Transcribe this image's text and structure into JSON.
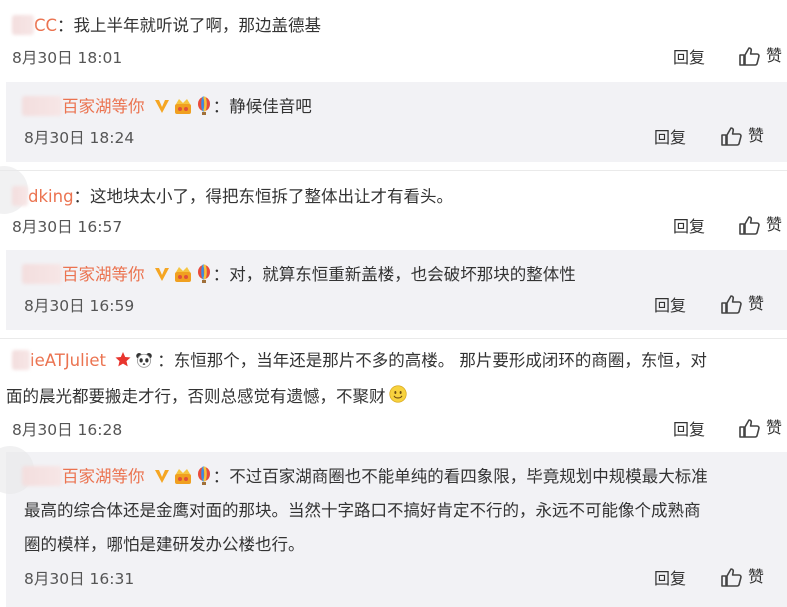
{
  "comments": [
    {
      "user_suffix": "CC",
      "separator": "：",
      "text": "我上半年就听说了啊，那边盖德基",
      "time": "8月30日 18:01",
      "reply_label": "回复",
      "like_label": "赞",
      "reply": {
        "user": "百家湖等你",
        "separator": "：",
        "text": "静候佳音吧",
        "time": "8月30日 18:24",
        "reply_label": "回复",
        "like_label": "赞"
      }
    },
    {
      "user_suffix": "dking",
      "separator": "：",
      "text": "这地块太小了，得把东恒拆了整体出让才有看头。",
      "time": "8月30日 16:57",
      "reply_label": "回复",
      "like_label": "赞",
      "reply": {
        "user": "百家湖等你",
        "separator": "：",
        "text": "对，就算东恒重新盖楼，也会破坏那块的整体性",
        "time": "8月30日 16:59",
        "reply_label": "回复",
        "like_label": "赞"
      }
    },
    {
      "user_suffix": "ieATJuliet",
      "separator": "：",
      "text_line1": "东恒那个，当年还是那片不多的高楼。 那片要形成闭环的商圈，东恒，对",
      "text_line2": "面的晨光都要搬走才行，否则总感觉有遗憾，不聚财",
      "time": "8月30日 16:28",
      "reply_label": "回复",
      "like_label": "赞",
      "reply": {
        "user": "百家湖等你",
        "separator": "：",
        "text_line1": "不过百家湖商圈也不能单纯的看四象限，毕竟规划中规模最大标准",
        "text_line2": "最高的综合体还是金鹰对面的那块。当然十字路口不搞好肯定不行的，永远不可能像个成熟商",
        "text_line3": "圈的模样，哪怕是建研发办公楼也行。",
        "time": "8月30日 16:31",
        "reply_label": "回复",
        "like_label": "赞"
      }
    }
  ]
}
